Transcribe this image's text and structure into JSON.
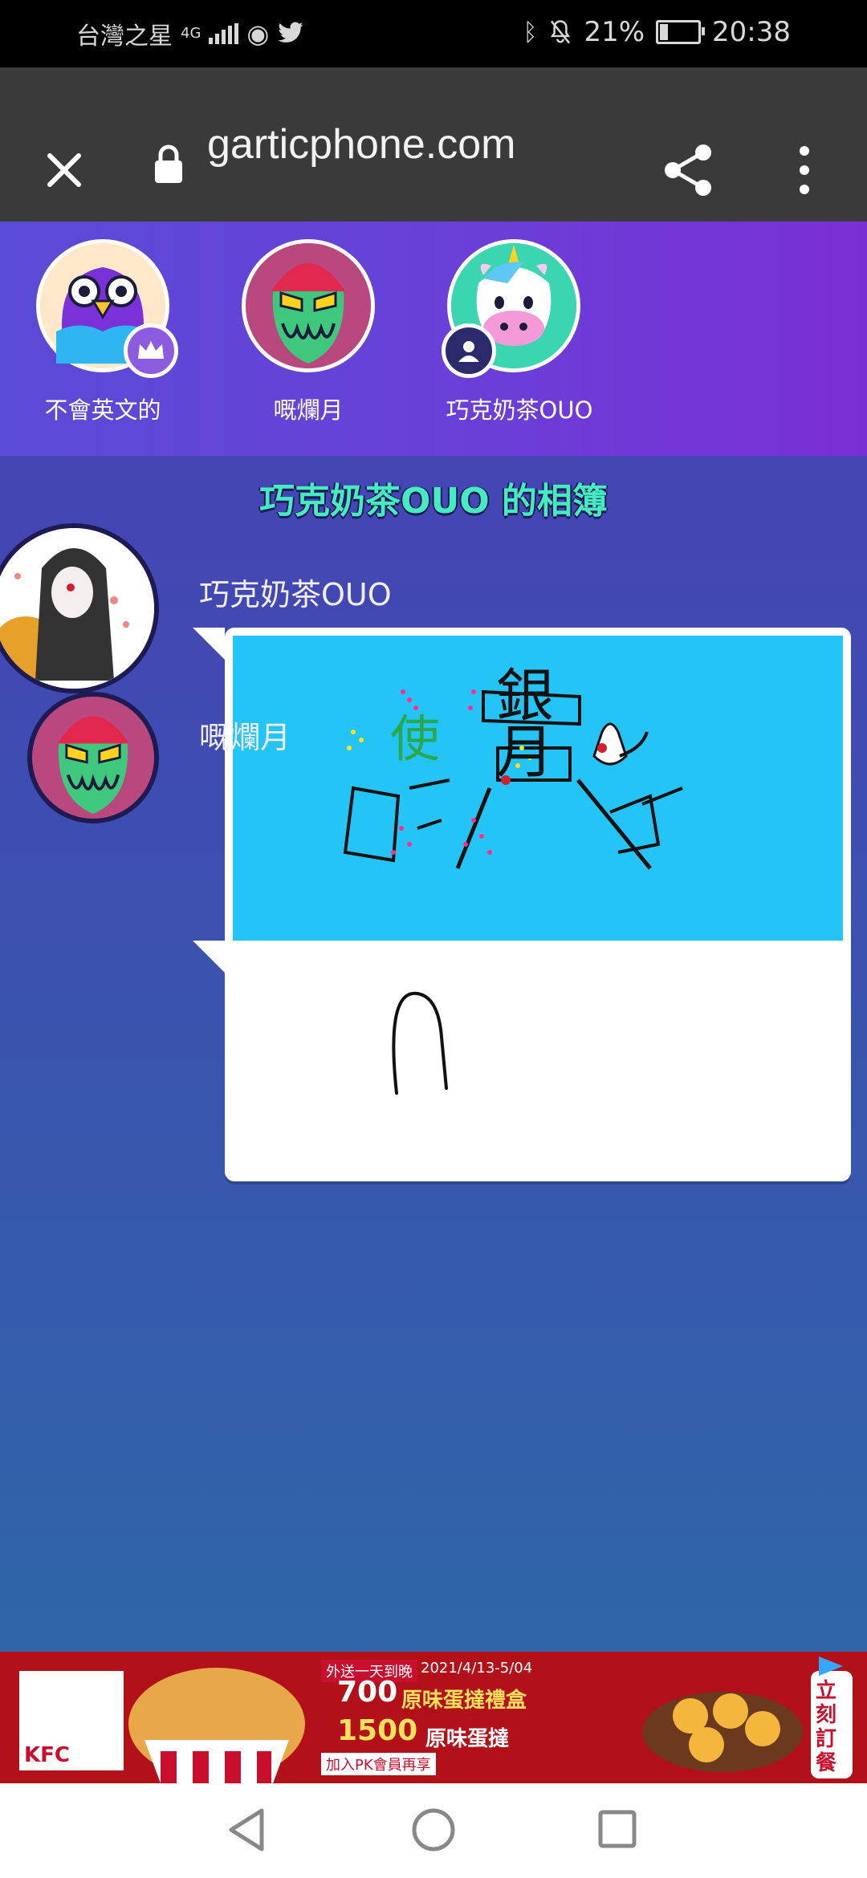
{
  "status_bar": {
    "carrier": "台灣之星",
    "network": "4G",
    "battery": "21%",
    "time": "20:38"
  },
  "browser": {
    "url": "garticphone.com",
    "icons": [
      "close-icon",
      "lock-icon",
      "share-icon",
      "more-vert-icon"
    ]
  },
  "players": [
    {
      "name": "不會英文的",
      "avatar": "purple-bird",
      "badge": "crown-icon"
    },
    {
      "name": "嘅爛月",
      "avatar": "green-pirate",
      "badge": ""
    },
    {
      "name": "巧克奶茶OUO",
      "avatar": "unicorn",
      "badge": "user-icon"
    }
  ],
  "album": {
    "title": "巧克奶茶OUO 的相簿",
    "entries": [
      {
        "author": "巧克奶茶OUO",
        "drawing_text": [
          "銀",
          "月",
          "使"
        ]
      },
      {
        "author": "嘅爛月"
      }
    ]
  },
  "ad": {
    "brand": "KFC",
    "date_range": "2021/4/13-5/04",
    "tag": "外送一天到晚",
    "line1_price": "700",
    "line1_text": "原味蛋撻禮盒",
    "line2_price": "1500",
    "line2_text": "原味蛋撻",
    "line3": "加入PK會員再享",
    "cta": "立刻訂餐"
  },
  "colors": {
    "accent_title": "#45ecc0",
    "app_bg": "#4a3fb6",
    "drawing_sky": "#24c4f7"
  }
}
